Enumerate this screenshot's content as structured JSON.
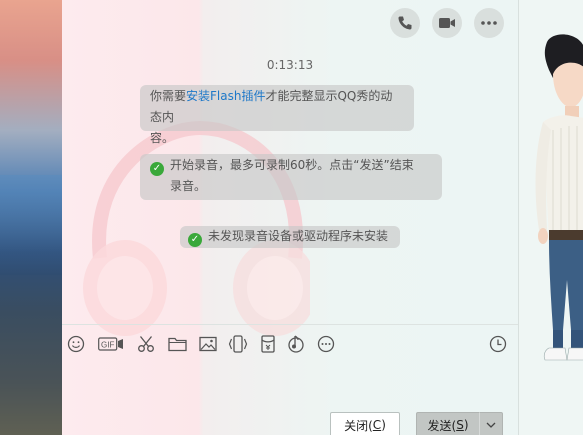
{
  "header": {
    "icons": [
      "phone-icon",
      "video-camera-icon",
      "more-icon"
    ]
  },
  "chat": {
    "timestamp": "0:13:13",
    "messages": [
      {
        "prefix": "你需要",
        "link": "安装Flash插件",
        "suffix_line1": "才能完整显示QQ秀的动态内",
        "line2": "容。"
      },
      {
        "icon": "check-icon",
        "line1": "开始录音，最多可录制60秒。点击“发送”结束",
        "line2": "录音。"
      },
      {
        "icon": "check-icon",
        "text": "未发现录音设备或驱动程序未安装"
      }
    ]
  },
  "toolbar": {
    "gif_label": "GIF",
    "icons": [
      "emoji-icon",
      "gif-icon",
      "scissors-icon",
      "folder-icon",
      "image-icon",
      "shake-icon",
      "red-packet-icon",
      "music-icon",
      "more-icon",
      "history-clock-icon"
    ]
  },
  "footer": {
    "close_label": "关闭(",
    "close_key": "C",
    "close_end": ")",
    "send_label": "发送(",
    "send_key": "S",
    "send_end": ")"
  },
  "colors": {
    "link": "#1e78c8",
    "success": "#3aa83a",
    "bubble": "#c8c8c8"
  }
}
